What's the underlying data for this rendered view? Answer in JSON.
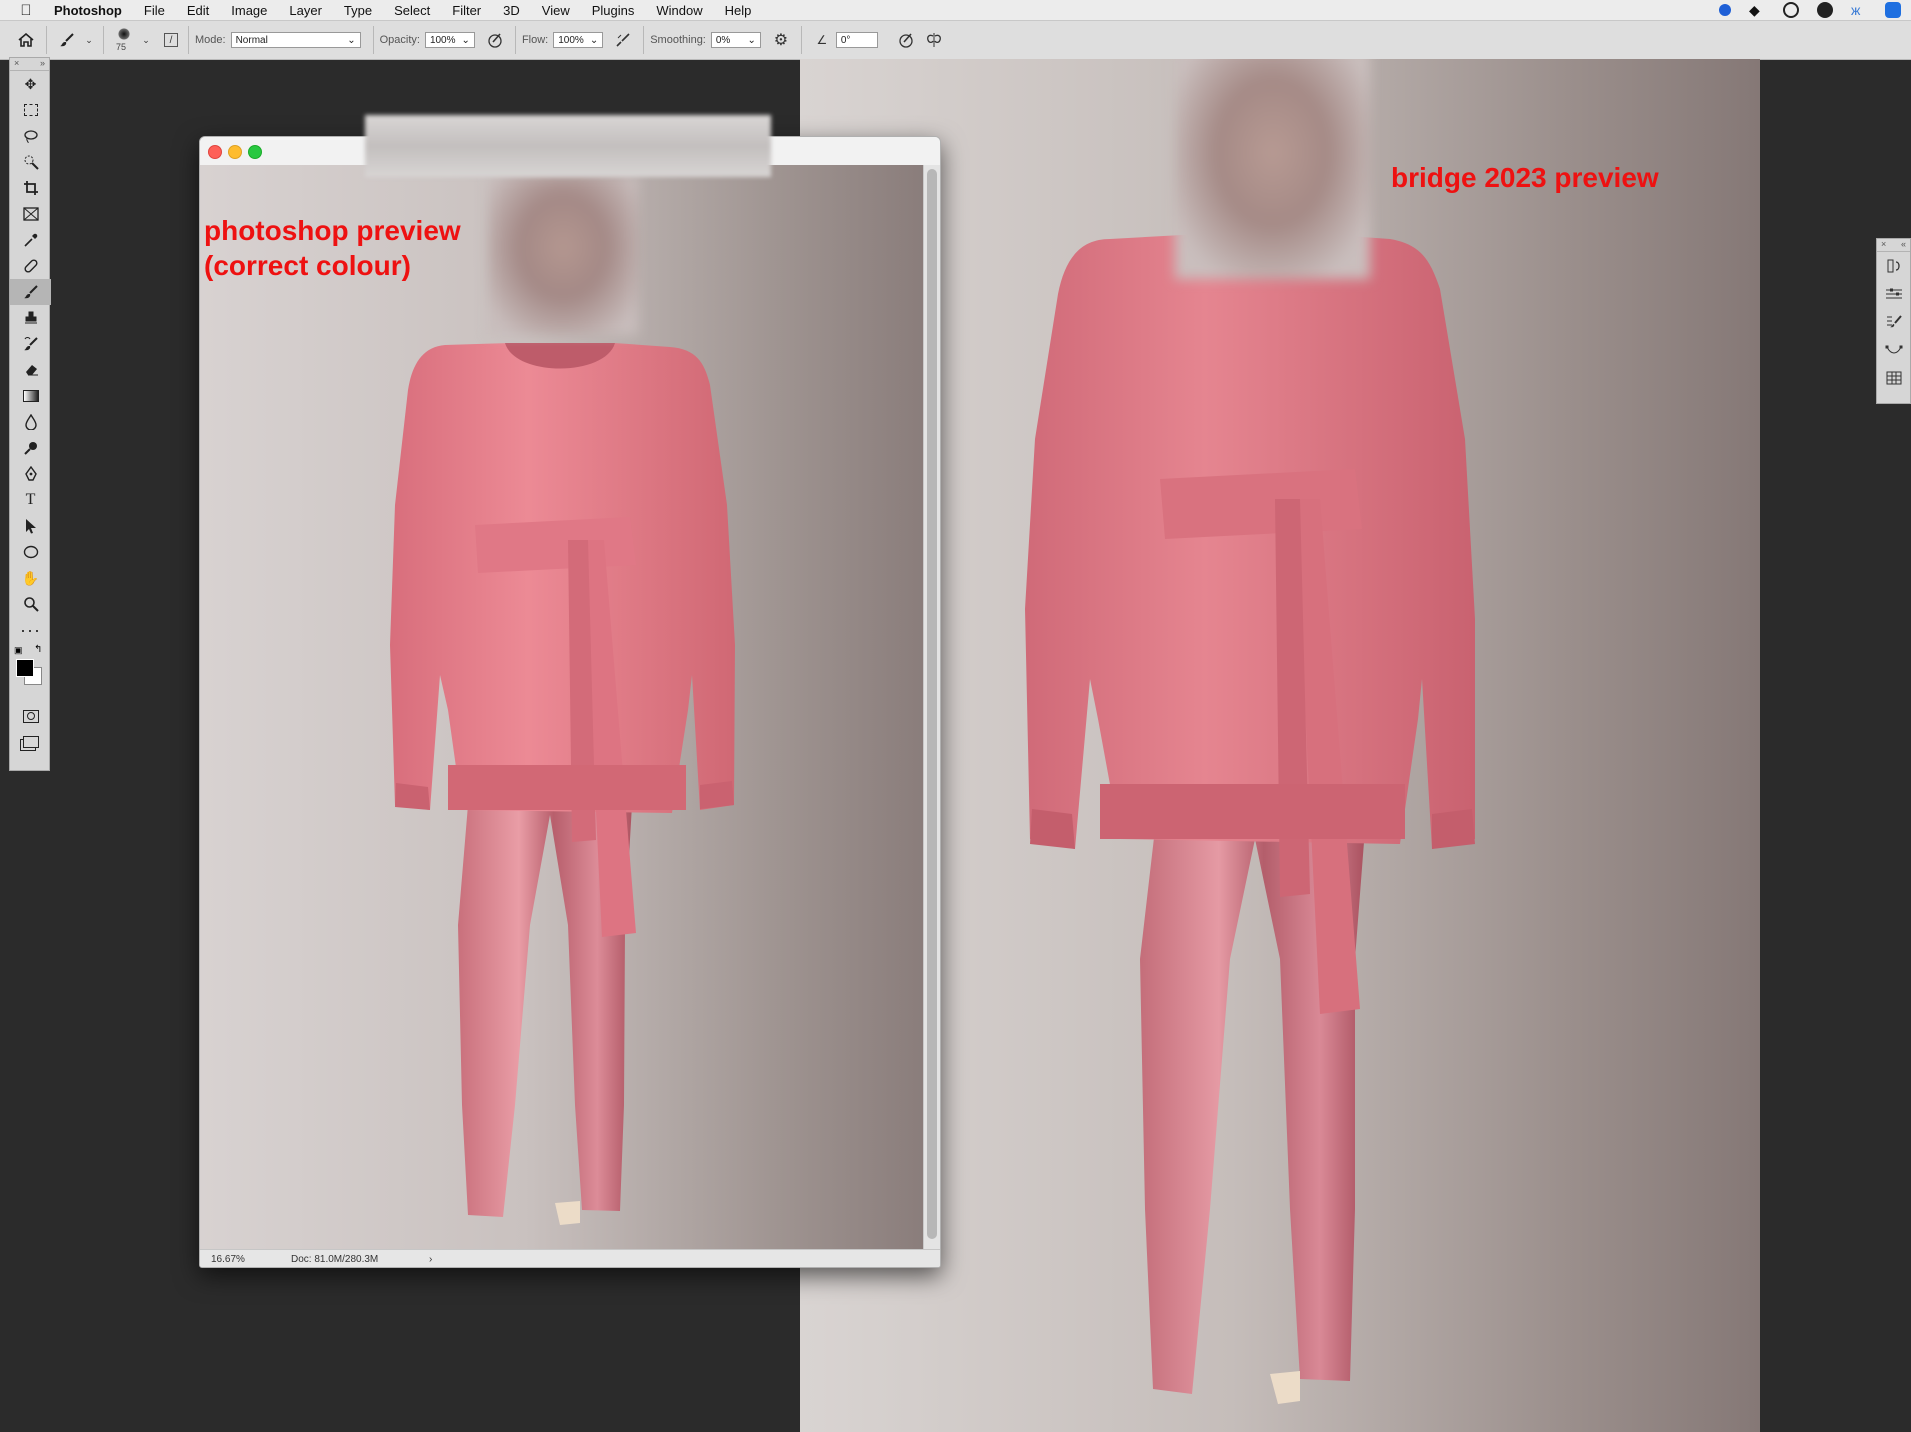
{
  "menubar": {
    "app": "Photoshop",
    "items": [
      "File",
      "Edit",
      "Image",
      "Layer",
      "Type",
      "Select",
      "Filter",
      "3D",
      "View",
      "Plugins",
      "Window",
      "Help"
    ]
  },
  "options": {
    "brush_size": "75",
    "mode_label": "Mode:",
    "mode_value": "Normal",
    "opacity_label": "Opacity:",
    "opacity_value": "100%",
    "flow_label": "Flow:",
    "flow_value": "100%",
    "smoothing_label": "Smoothing:",
    "smoothing_value": "0%",
    "angle_value": "0°"
  },
  "document": {
    "zoom": "16.67%",
    "doc_info": "Doc: 81.0M/280.3M",
    "arrow": "›"
  },
  "annotations": {
    "left_line1": "photoshop preview",
    "left_line2": "(correct colour)",
    "right": "bridge 2023 preview"
  },
  "colors": {
    "accent_red": "#ee1111",
    "sweater_pink": "#e07a87",
    "trouser_pink": "#d47a86",
    "close": "#fe5f57",
    "minimize": "#febc2e",
    "zoom": "#28c840"
  },
  "icons": {
    "status": [
      "status-blue-icon",
      "dropbox-icon",
      "creative-cloud-icon",
      "grammarly-icon",
      "butterfly-icon",
      "teamviewer-icon"
    ]
  }
}
